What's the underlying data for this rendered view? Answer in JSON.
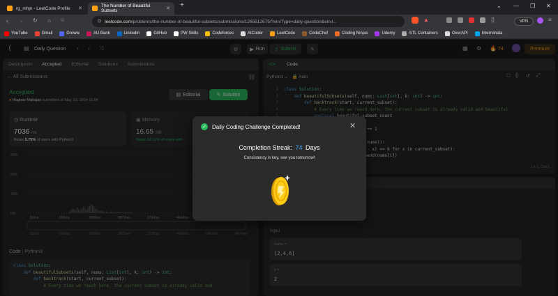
{
  "browser": {
    "tabs": [
      {
        "title": "rg_mhjn - LeetCode Profile"
      },
      {
        "title": "The Number of Beautiful Subsets"
      }
    ],
    "url_host": "leetcode.com",
    "url_path": "/problems/the-number-of-beautiful-subsets/submissions/1265512675/?envType=daily-question&envi...",
    "vpn_label": "VPN",
    "bookmarks": [
      {
        "label": "YouTube",
        "color": "#ff0000"
      },
      {
        "label": "Gmail",
        "color": "#ea4335"
      },
      {
        "label": "Groww",
        "color": "#5367ff"
      },
      {
        "label": "AU Bank",
        "color": "#c2185b"
      },
      {
        "label": "LinkedIn",
        "color": "#0a66c2"
      },
      {
        "label": "GitHub",
        "color": "#ffffff"
      },
      {
        "label": "PW Skills",
        "color": "#ffffff"
      },
      {
        "label": "Codeforces",
        "color": "#f4c20d"
      },
      {
        "label": "AtCoder",
        "color": "#dddddd"
      },
      {
        "label": "LeetCode",
        "color": "#ffa116"
      },
      {
        "label": "CodeChef",
        "color": "#8b5a2b"
      },
      {
        "label": "Coding Ninjas",
        "color": "#f26b24"
      },
      {
        "label": "Udemy",
        "color": "#a435f0"
      },
      {
        "label": "STL Containers",
        "color": "#aaaaaa"
      },
      {
        "label": "OverAPI",
        "color": "#dddddd"
      },
      {
        "label": "Internshala",
        "color": "#00a5ec"
      }
    ]
  },
  "header": {
    "daily_question": "Daily Question",
    "run": "Run",
    "submit": "Submit",
    "streak_count": "74",
    "premium": "Premium"
  },
  "left": {
    "tabs": [
      "Description",
      "Accepted",
      "Editorial",
      "Solutions",
      "Submissions"
    ],
    "back_label": "All Submissions",
    "status": "Accepted",
    "user": "Raghav Mahajan",
    "submitted_text": "submitted at May 23, 2024 11:54",
    "editorial_btn": "Editorial",
    "solution_btn": "Solution",
    "runtime_label": "Runtime",
    "runtime_value": "7036",
    "runtime_unit": "ms",
    "runtime_beats_prefix": "Beats",
    "runtime_beats_pct": "5.75%",
    "runtime_beats_suffix": "of users with Python3",
    "memory_label": "Memory",
    "memory_value": "16.65",
    "memory_unit": "MB",
    "memory_beats": "Beats 32.01% of users with",
    "chart_yticks": [
      "30%",
      "20%",
      "10%",
      "0%"
    ],
    "chart_xticks": [
      "83ms",
      "896ms",
      "1908ms",
      "2872ms",
      "3730ms",
      "4648ms",
      "5561ms",
      "6474ms"
    ],
    "code_label": "Code",
    "lang_label": "Python3"
  },
  "editor": {
    "title": "Code",
    "lang": "Python3",
    "auto": "Auto",
    "line_numbers": [
      "1",
      "2",
      "3",
      "4",
      "5",
      "6",
      "7",
      "8",
      "9",
      "10",
      "11",
      "12"
    ],
    "cursor_pos": "Ln 1, Col 1"
  },
  "testcase": {
    "input_label": "Input",
    "nums_label": "nums =",
    "nums_value": "[2,4,6]",
    "k_label": "k =",
    "k_value": "2"
  },
  "modal": {
    "title": "Daily Coding Challenge Completed!",
    "streak_label": "Completion Streak:",
    "streak_value": "74",
    "streak_unit": "Days",
    "message": "Consistency is key, see you tomorrow!",
    "accent": "#2cbb5d",
    "streak_color": "#3ea6ff"
  }
}
